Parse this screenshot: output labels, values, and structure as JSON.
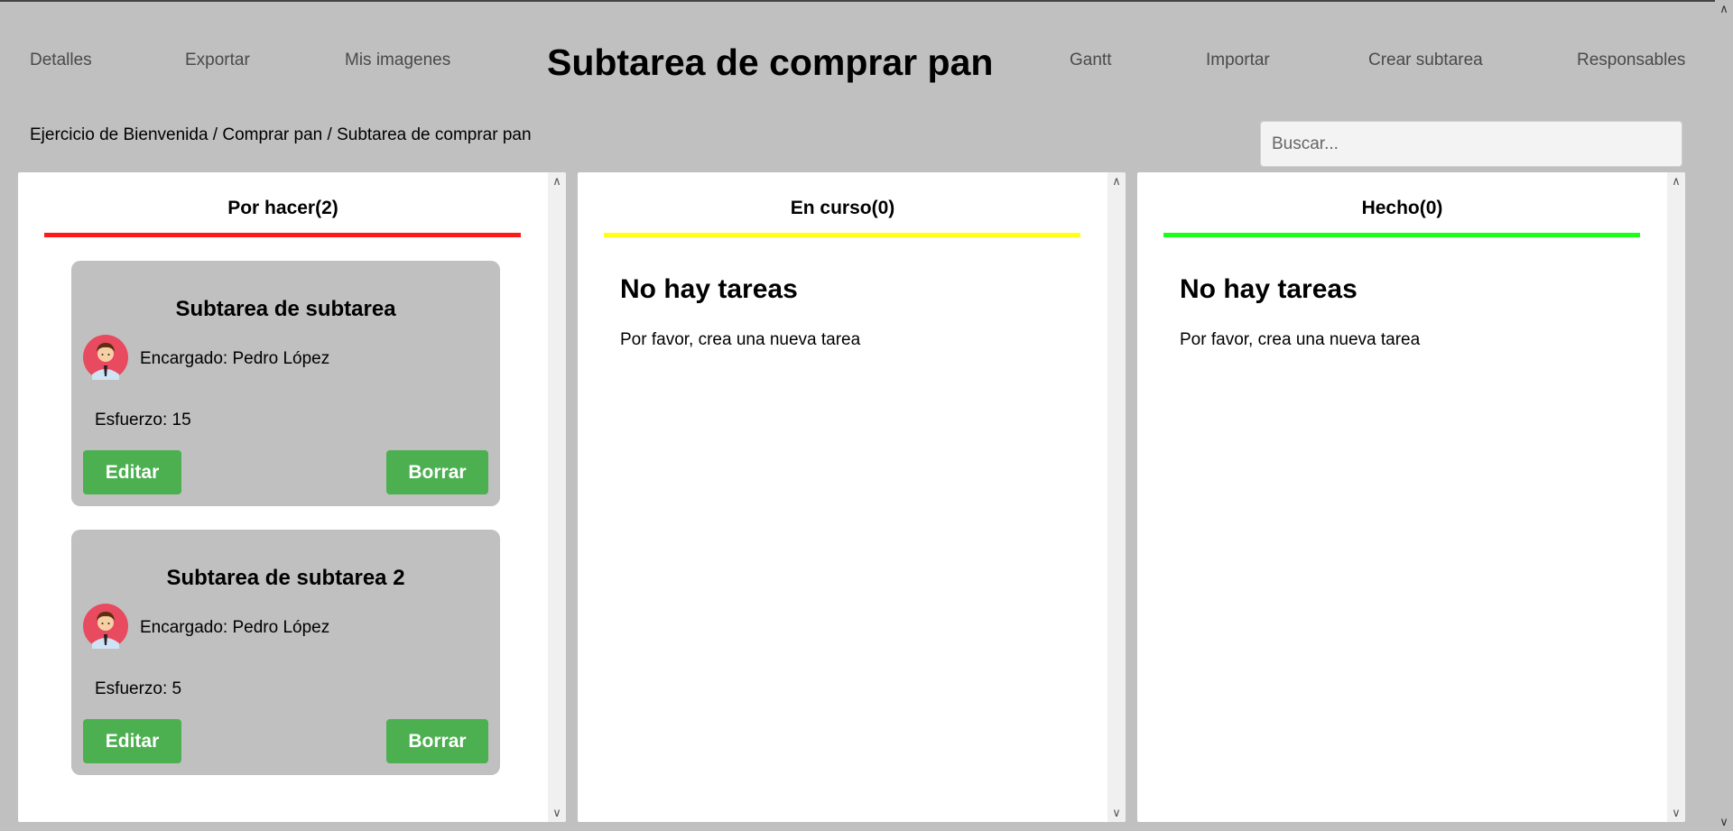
{
  "header": {
    "title": "Subtarea de comprar pan",
    "nav_left": [
      "Detalles",
      "Exportar",
      "Mis imagenes"
    ],
    "nav_right": [
      "Gantt",
      "Importar",
      "Crear subtarea",
      "Responsables"
    ]
  },
  "breadcrumb": {
    "items": [
      "Ejercicio de Bienvenida",
      "Comprar pan",
      "Subtarea de comprar pan"
    ],
    "separator": " / "
  },
  "search": {
    "placeholder": "Buscar..."
  },
  "columns": [
    {
      "title": "Por hacer(2)",
      "color": "#ff1a1a",
      "cards": [
        {
          "title": "Subtarea de subtarea",
          "assignee": "Encargado: Pedro López",
          "effort": "Esfuerzo: 15",
          "edit_label": "Editar",
          "delete_label": "Borrar"
        },
        {
          "title": "Subtarea de subtarea 2",
          "assignee": "Encargado: Pedro López",
          "effort": "Esfuerzo: 5",
          "edit_label": "Editar",
          "delete_label": "Borrar"
        }
      ]
    },
    {
      "title": "En curso(0)",
      "color": "#ffff1a",
      "empty_title": "No hay tareas",
      "empty_message": "Por favor, crea una nueva tarea"
    },
    {
      "title": "Hecho(0)",
      "color": "#1aff1a",
      "empty_title": "No hay tareas",
      "empty_message": "Por favor, crea una nueva tarea"
    }
  ],
  "colors": {
    "background": "#c0c0c0",
    "button": "#4caf50",
    "avatar": "#e84a5f"
  },
  "icons": {
    "avatar": "person-avatar-icon",
    "scroll_up": "chevron-up-icon",
    "scroll_down": "chevron-down-icon"
  }
}
